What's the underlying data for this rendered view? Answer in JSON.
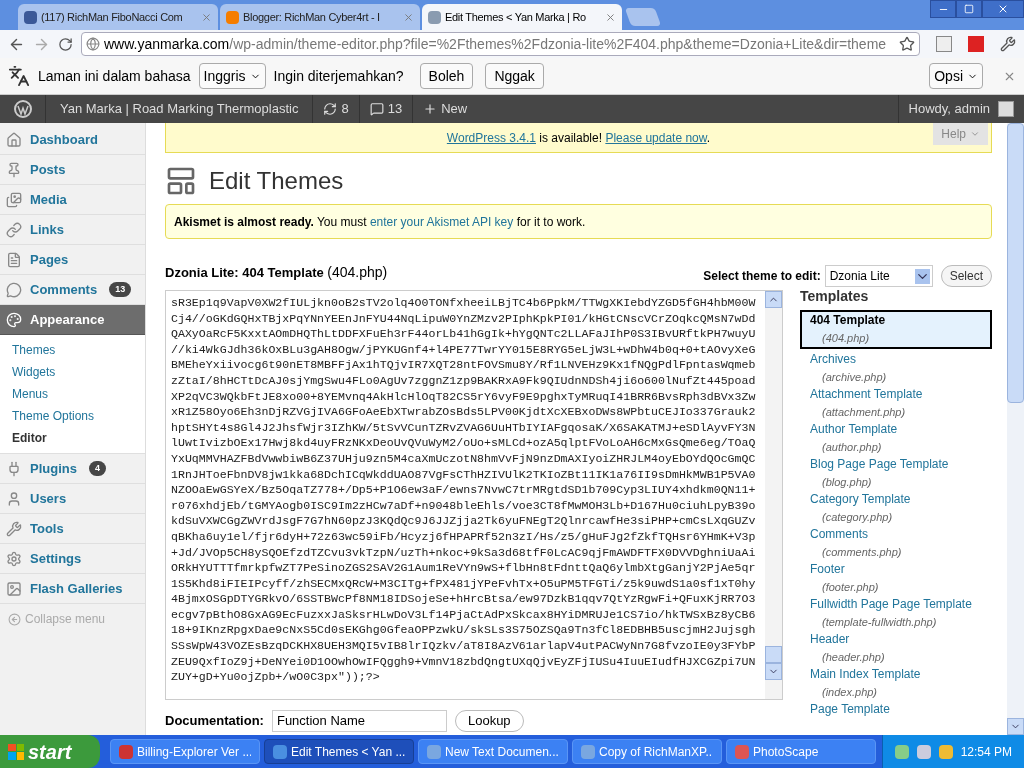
{
  "browser": {
    "tabs": [
      {
        "title": "(117) RichMan FiboNacci Com",
        "selected": false
      },
      {
        "title": "Blogger: RichMan Cyber4rt - I",
        "selected": false
      },
      {
        "title": "Edit Themes < Yan Marka | Ro",
        "selected": true
      }
    ],
    "url": {
      "host": "www.yanmarka.com",
      "path": "/wp-admin/theme-editor.php?file=%2Fthemes%2Fdzonia-lite%2F404.php&theme=Dzonia+Lite&dir=theme"
    },
    "translate_bar": {
      "prefix": "Laman ini dalam bahasa",
      "language": "Inggris",
      "question": "Ingin diterjemahkan?",
      "yes": "Boleh",
      "no": "Nggak",
      "options": "Opsi"
    }
  },
  "admin_bar": {
    "site_name": "Yan Marka | Road Marking Thermoplastic",
    "updates": "8",
    "comments": "13",
    "new": "New",
    "greeting": "Howdy, admin"
  },
  "sidebar": {
    "items": [
      {
        "label": "Dashboard",
        "selected": false
      },
      {
        "label": "Posts",
        "selected": false
      },
      {
        "label": "Media",
        "selected": false
      },
      {
        "label": "Links",
        "selected": false
      },
      {
        "label": "Pages",
        "selected": false
      },
      {
        "label": "Comments",
        "badge": "13",
        "selected": false
      },
      {
        "label": "Appearance",
        "selected": true,
        "children": [
          {
            "label": "Themes",
            "selected": false
          },
          {
            "label": "Widgets",
            "selected": false
          },
          {
            "label": "Menus",
            "selected": false
          },
          {
            "label": "Theme Options",
            "selected": false
          },
          {
            "label": "Editor",
            "selected": true
          }
        ]
      },
      {
        "label": "Plugins",
        "badge": "4",
        "selected": false
      },
      {
        "label": "Users",
        "selected": false
      },
      {
        "label": "Tools",
        "selected": false
      },
      {
        "label": "Settings",
        "selected": false
      },
      {
        "label": "Flash Galleries",
        "selected": false
      }
    ],
    "collapse": "Collapse menu"
  },
  "update_nag": {
    "version_link": "WordPress 3.4.1",
    "middle": " is available! ",
    "update_link": "Please update now",
    "end": "."
  },
  "help_tab": "Help",
  "page_title": "Edit Themes",
  "akismet_notice": {
    "bold": "Akismet is almost ready.",
    "before": " You must ",
    "link": "enter your Akismet API key",
    "after": " for it to work."
  },
  "file_heading": {
    "title": "Dzonia Lite: 404 Template",
    "file": "(404.php)"
  },
  "theme_select": {
    "label": "Select theme to edit:",
    "value": "Dzonia Lite",
    "button": "Select"
  },
  "editor": {
    "lines": [
      "sR3Ep1q9VapV0XW2fIULjkn0oB2sTV2olq4O0TONfxheeiLBjTC4b6PpkM/TTWgXKIebdYZGD5fGH4hbM00W",
      "Cj4//oGKdGQHxTBjxPqYNnYEEnJnFYU44NqLipuW0YnZMzv2PIphKpkPI01/kHGtCNscVCrZOqkcQMsN7wDd",
      "QAXyOaRcF5KxxtAOmDHQThLtDDFXFuEh3rF44orLb41hGgIk+hYgQNTc2LLAFaJIhP0S3IBvURftkPH7wuyU",
      "//ki4WkGJdh36kOxBLu3gAH8Ogw/jPYKUGnf4+l4PE77TwrYY015E8RYG5eLjW3L+wDhW4b0q+0+tAOvyXeG",
      "BMEheYxiivocg6t90nET8MBFFjAx1hTQjvIR7XQT28ntFOVSmu8Y/Rf1LNVEHz9Kx1fNQgPdlFpntasWqmeb",
      "zZtaI/8hHCTtDcAJ0sjYmgSwu4FLo0AgUv7zggnZ1zp9BAKRxA9Fk9QIUdnNDSh4ji6o600lNufZt445poad",
      "XP2qVC3WQkbFtJE8xo00+8YEMvnq4AkHlcHlOqT82CS5rY6vyF9E9pghxTyMRuqI41BRR6BvsRph3dBVx3Zw",
      "xR1Z58Oyo6Eh3nDjRZVGjIVA6GFoAeEbXTwrabZOsBds5LPV00KjdtXcXEBxoDWs8WPbtuCEJIo337Grauk2",
      "hptSHYt4s8Gl4J2JhsfWjr3IZhKW/5tSvVCunTZRvZVAG6UuHTbIYIAFgqosaK/X6SAKATMJ+eSDlAyvFY3N",
      "lUwtIvizbOEx17Hwj8kd4uyFRzNKxDeoUvQVuWyM2/oUo+sMLCd+ozA5qlptFVoLoAH6cMxGsQme6eg/TOaQ",
      "YxUqMMVHAZFBdVwwbiwB6Z37UHju9zn5M4caXmUczotN8hmVvFjN9nzDmAXIyoiZHRJLM4oyEbOYdQOcGmQC",
      "1RnJHToeFbnDV8jw1kka68DchICqWkddUAO87VgFsCThHZIVUlK2TKIoZBt11IK1a76II9sDmHkMWB1P5VA0",
      "NZOOaEwGSYeX/Bz5OqaTZ778+/Dp5+P1O6ew3aF/ewns7NvwC7trMRgtdSD1b709Cyp3LIUY4xhdkm0QN11+",
      "r076xhdjEb/tGMYAogb0ISC9Im2zHCw7aDf+n9048bleEhls/voe3CT8fMwMOH3Lb+D167Hu0ciuhLpyB39o",
      "kdSuVXWCGgZWVrdJsgF7G7hN60pzJ3KQdQc9J6JJZjja2Tk6yuFNEgT2QlnrcawfHe3siPHP+cmCsLXqGUZv",
      "qBKha6uy1el/fjr6dyH+72z63wc59iFb/Hcyzj6fHPAPRf52n3zI/Hs/z5/gHuFJg2fZkfTQHsr6YHmK+V3p",
      "+Jd/JVOp5CH8ySQOEfzdTZCvu3vkTzpN/uzTh+nkoc+9kSa3d68tfF0LcAC9qjFmAWDFTFX0DVVDghniUaAi",
      "ORkHYUTTTfmrkpfwZT7PeSinoZGS2SAV2G1Aum1ReVYn9wS+flbHn8tFdnttQaQ6ylmbXtgGanjY2PjAe5qr",
      "1S5Khd8iFIEIPcyff/zhSECMxQRcW+M3CITg+fPX481jYPeFvhTx+O5uPM5TFGTi/z5k9uwdS1a0sf1xT0hy",
      "4BjmxOSGpDTYGRkvO/6SSTBWcPf8NM18IDSojeSe+hHrcBtsa/ew97DzkB1qqv7QtYzRgwFi+QFuxKjRR7O3",
      "ecgv7pBthO8GxAG9EcFuzxxJaSksrHLwDoV3Lf14PjaCtAdPxSkcax8HYiDMRUJe1CS7io/hkTWSxBz8yCB6",
      "18+9IKnzRpgxDae9cNxS5Cd0sEKGhg0GfeaOPPzwkU/skSLs3S75OZSQa9Tn3fCl8EDBHB5uscjmH2Jujsgh",
      "SSsWpW43VOZEsBzqDCKHX8UEH3MQI5vIB8lrIQzkv/aT8I8AzV61arlapV4utPACWyNn7G8fvzoIE0y3FYbP",
      "ZEU9QxfIoZ9j+DeNYei0D1OOwhOwIFQggh9+VmnV18zbdQngtUXqQjvEyZFjIUSu4IuuEIudfHJXCGZpi7UN",
      "ZUY+gD+Yu0ojZpb+/wO0C3px\"));?>"
    ]
  },
  "templates": {
    "heading": "Templates",
    "items": [
      {
        "name": "404 Template",
        "file": "(404.php)",
        "selected": true
      },
      {
        "name": "Archives",
        "file": "(archive.php)",
        "selected": false
      },
      {
        "name": "Attachment Template",
        "file": "(attachment.php)",
        "selected": false
      },
      {
        "name": "Author Template",
        "file": "(author.php)",
        "selected": false
      },
      {
        "name": "Blog Page Page Template",
        "file": "(blog.php)",
        "selected": false
      },
      {
        "name": "Category Template",
        "file": "(category.php)",
        "selected": false
      },
      {
        "name": "Comments",
        "file": "(comments.php)",
        "selected": false
      },
      {
        "name": "Footer",
        "file": "(footer.php)",
        "selected": false
      },
      {
        "name": "Fullwidth Page Page Template",
        "file": "(template-fullwidth.php)",
        "selected": false
      },
      {
        "name": "Header",
        "file": "(header.php)",
        "selected": false
      },
      {
        "name": "Main Index Template",
        "file": "(index.php)",
        "selected": false
      },
      {
        "name": "Page Template",
        "selected": false
      }
    ]
  },
  "documentation": {
    "label": "Documentation:",
    "select": "Function Name",
    "button": "Lookup"
  },
  "taskbar": {
    "start": "start",
    "items": [
      {
        "label": "Billing-Explorer Ver ...",
        "selected": false
      },
      {
        "label": "Edit Themes < Yan ...",
        "selected": true
      },
      {
        "label": "New Text Documen...",
        "selected": false
      },
      {
        "label": "Copy of RichManXP...",
        "selected": false
      },
      {
        "label": "PhotoScape",
        "selected": false
      }
    ],
    "clock": "12:54 PM"
  }
}
